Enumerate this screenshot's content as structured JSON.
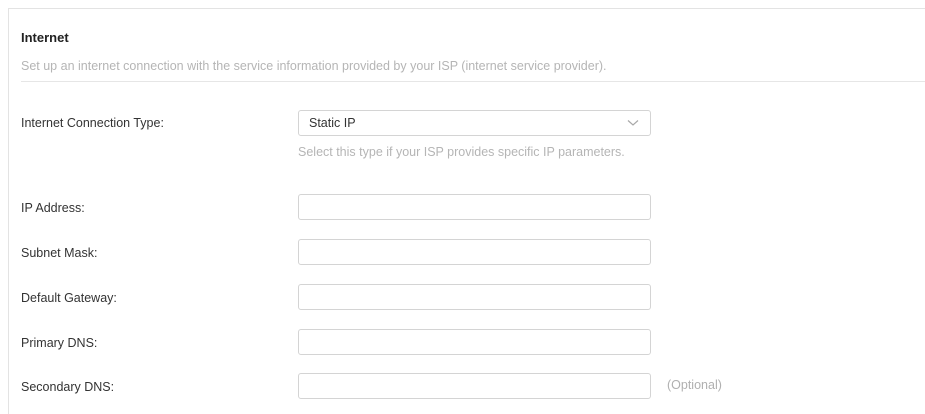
{
  "section": {
    "title": "Internet",
    "description": "Set up an internet connection with the service information provided by your ISP (internet service provider)."
  },
  "connection_type": {
    "label": "Internet Connection Type:",
    "selected": "Static IP",
    "hint": "Select this type if your ISP provides specific IP parameters."
  },
  "fields": {
    "ip_address": {
      "label": "IP Address:",
      "value": ""
    },
    "subnet_mask": {
      "label": "Subnet Mask:",
      "value": ""
    },
    "default_gateway": {
      "label": "Default Gateway:",
      "value": ""
    },
    "primary_dns": {
      "label": "Primary DNS:",
      "value": ""
    },
    "secondary_dns": {
      "label": "Secondary DNS:",
      "value": "",
      "note": "(Optional)"
    }
  },
  "icons": {
    "dropdown": "chevron-down-icon"
  },
  "colors": {
    "border": "#d4d4d4",
    "hint_text": "#b5b5b5",
    "label_text": "#333333"
  }
}
